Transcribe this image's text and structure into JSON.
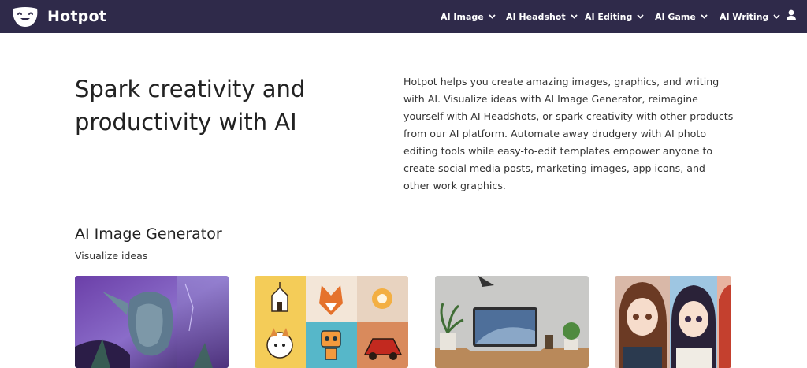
{
  "brand": {
    "name": "Hotpot"
  },
  "nav": {
    "items": [
      {
        "label": "AI Image"
      },
      {
        "label": "AI Headshot"
      },
      {
        "label": "AI Editing"
      },
      {
        "label": "AI Game"
      },
      {
        "label": "AI Writing"
      }
    ]
  },
  "hero": {
    "title": "Spark creativity and productivity with AI",
    "description": "Hotpot helps you create amazing images, graphics, and writing with AI. Visualize ideas with AI Image Generator, reimagine yourself with AI Headshots, or spark creativity with other products from our AI platform. Automate away drudgery with AI photo editing tools while easy-to-edit templates empower anyone to create social media posts, marketing images, app icons, and other work graphics."
  },
  "section": {
    "title": "AI Image Generator",
    "subtitle": "Visualize ideas"
  },
  "colors": {
    "nav_bg": "#2f2a4a",
    "text": "#222222"
  }
}
